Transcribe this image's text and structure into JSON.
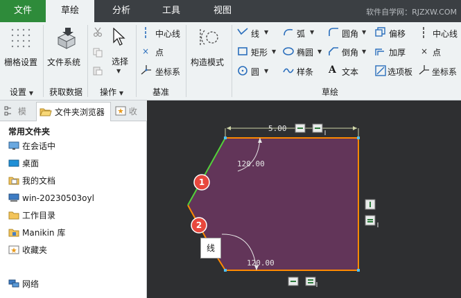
{
  "tabs": [
    {
      "label": "文件"
    },
    {
      "label": "草绘"
    },
    {
      "label": "分析"
    },
    {
      "label": "工具"
    },
    {
      "label": "视图"
    }
  ],
  "watermark": "软件自学网：RJZXW.COM",
  "ribbon": {
    "setup": {
      "grid_settings": "栅格设置",
      "group": "设置"
    },
    "get_data": {
      "file_system": "文件系统",
      "group": "获取数据"
    },
    "operations": {
      "select": "选择",
      "group": "操作"
    },
    "datum": {
      "centerline": "中心线",
      "point": "点",
      "coord_sys": "坐标系",
      "group": "基准"
    },
    "construct": {
      "construction_mode": "构造模式"
    },
    "sketch": {
      "line": "线",
      "rectangle": "矩形",
      "circle": "圆",
      "arc": "弧",
      "ellipse": "椭圆",
      "spline": "样条",
      "fillet": "圆角",
      "chamfer": "倒角",
      "text": "文本",
      "offset": "偏移",
      "thicken": "加厚",
      "palette": "选项板",
      "centerline": "中心线",
      "point": "点",
      "coord_sys": "坐标系",
      "group": "草绘"
    }
  },
  "left_panel": {
    "tab_model": "模",
    "tab_browser": "文件夹浏览器",
    "tab_fav": "收",
    "title": "常用文件夹",
    "items": [
      {
        "label": "在会话中"
      },
      {
        "label": "桌面"
      },
      {
        "label": "我的文档"
      },
      {
        "label": "win-20230503oyl"
      },
      {
        "label": "工作目录"
      },
      {
        "label": "Manikin 库"
      },
      {
        "label": "收藏夹"
      },
      {
        "label": "网络"
      }
    ]
  },
  "sketch": {
    "dim_top": "5.00",
    "angle_top": "120.00",
    "angle_bottom": "120.00",
    "marker_1": "1",
    "marker_2": "2",
    "tooltip": "线",
    "colors": {
      "fill": "#623559",
      "edge": "#ff8a00",
      "selected": "#53d23a",
      "marker": "#e8473d"
    }
  }
}
